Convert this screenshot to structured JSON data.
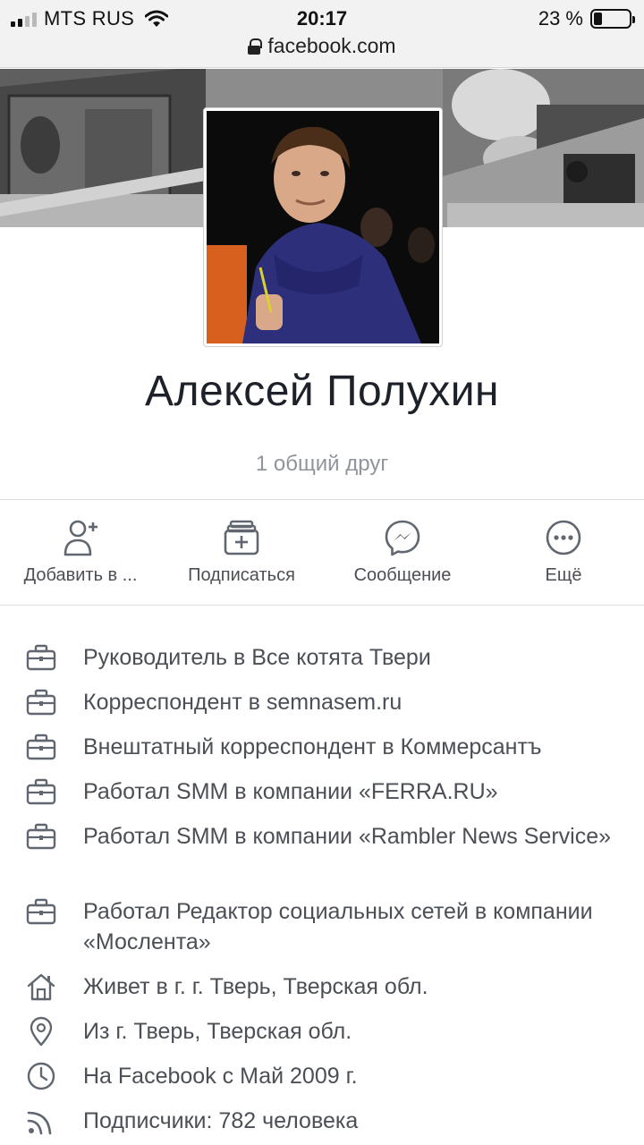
{
  "status_bar": {
    "carrier": "MTS RUS",
    "time": "20:17",
    "battery_text": "23 %",
    "battery_level": 0.23
  },
  "url_bar": {
    "url": "facebook.com"
  },
  "profile": {
    "name": "Алексей Полухин",
    "mutual_friends": "1 общий друг"
  },
  "actions": [
    {
      "label": "Добавить в ...",
      "icon": "add-friend-icon"
    },
    {
      "label": "Подписаться",
      "icon": "follow-icon"
    },
    {
      "label": "Сообщение",
      "icon": "messenger-icon"
    },
    {
      "label": "Ещё",
      "icon": "more-icon"
    }
  ],
  "info": [
    {
      "icon": "briefcase-icon",
      "text": "Руководитель в Все котята Твери"
    },
    {
      "icon": "briefcase-icon",
      "text": "Корреспондент в semnasem.ru"
    },
    {
      "icon": "briefcase-icon",
      "text": "Внештатный корреспондент в Коммерсантъ"
    },
    {
      "icon": "briefcase-icon",
      "text": "Работал SMM в компании «FERRA.RU»"
    },
    {
      "icon": "briefcase-icon",
      "text": "Работал SMM в компании «Rambler News Service»"
    },
    {
      "icon": "briefcase-icon",
      "text": "Работал Редактор социальных сетей в компании «Мослента»"
    },
    {
      "icon": "home-icon",
      "text": "Живет в г. г. Тверь, Тверская обл."
    },
    {
      "icon": "location-pin-icon",
      "text": "Из г. Тверь, Тверская обл."
    },
    {
      "icon": "clock-icon",
      "text": "На Facebook с Май 2009 г."
    },
    {
      "icon": "rss-icon",
      "text": "Подписчики: 782 человека"
    }
  ],
  "colors": {
    "text_primary": "#1d2129",
    "text_secondary": "#4b4f56",
    "text_muted": "#90949c",
    "icon_gray": "#606770"
  }
}
